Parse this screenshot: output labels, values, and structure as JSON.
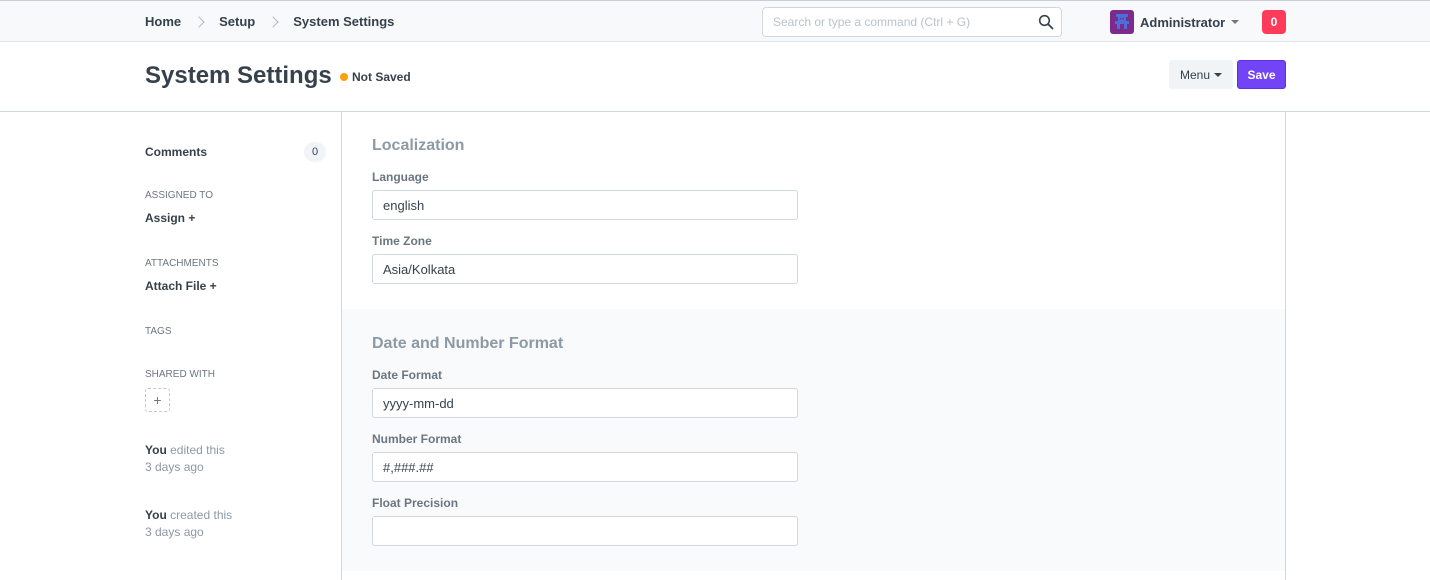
{
  "navbar": {
    "breadcrumbs": [
      "Home",
      "Setup",
      "System Settings"
    ],
    "search_placeholder": "Search or type a command (Ctrl + G)",
    "user_name": "Administrator",
    "notification_count": "0"
  },
  "page": {
    "title": "System Settings",
    "status": "Not Saved",
    "status_color": "#ffa00a",
    "menu_label": "Menu",
    "save_label": "Save",
    "save_color": "#7344f5"
  },
  "sidebar": {
    "comments_label": "Comments",
    "comments_count": "0",
    "assigned_to_label": "Assigned To",
    "assign_action": "Assign +",
    "attachments_label": "Attachments",
    "attach_action": "Attach File +",
    "tags_label": "Tags",
    "shared_with_label": "Shared With",
    "share_add": "+",
    "timeline": [
      {
        "actor": "You",
        "action": "edited this",
        "time": "3 days ago"
      },
      {
        "actor": "You",
        "action": "created this",
        "time": "3 days ago"
      }
    ]
  },
  "form": {
    "sections": [
      {
        "title": "Localization",
        "fields": [
          {
            "label": "Language",
            "value": "english"
          },
          {
            "label": "Time Zone",
            "value": "Asia/Kolkata"
          }
        ]
      },
      {
        "title": "Date and Number Format",
        "fields": [
          {
            "label": "Date Format",
            "value": "yyyy-mm-dd"
          },
          {
            "label": "Number Format",
            "value": "#,###.##"
          },
          {
            "label": "Float Precision",
            "value": ""
          }
        ]
      }
    ]
  }
}
